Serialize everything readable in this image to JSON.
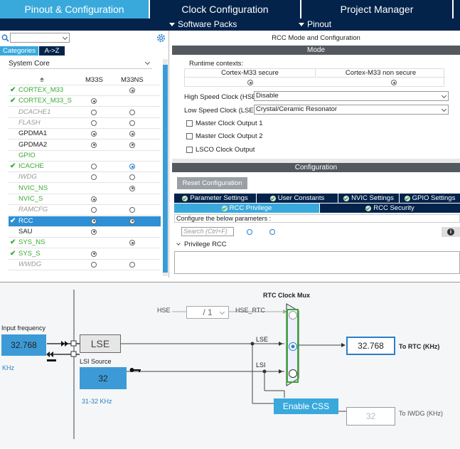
{
  "tabs": [
    "Pinout & Configuration",
    "Clock Configuration",
    "Project Manager"
  ],
  "subbar": {
    "software_packs": "Software Packs",
    "pinout": "Pinout"
  },
  "sidebar": {
    "categories_tab": "Categories",
    "az_tab": "A->Z",
    "group": "System Core",
    "col1": "M33S",
    "col2": "M33NS",
    "items": [
      {
        "name": "CORTEX_M33",
        "checked": true
      },
      {
        "name": "CORTEX_M33_S",
        "checked": true
      },
      {
        "name": "DCACHE1",
        "checked": false
      },
      {
        "name": "FLASH",
        "checked": false
      },
      {
        "name": "GPDMA1",
        "checked": false
      },
      {
        "name": "GPDMA2",
        "checked": false
      },
      {
        "name": "GPIO",
        "checked": false
      },
      {
        "name": "ICACHE",
        "checked": true
      },
      {
        "name": "IWDG",
        "checked": false
      },
      {
        "name": "NVIC_NS",
        "checked": false
      },
      {
        "name": "NVIC_S",
        "checked": false
      },
      {
        "name": "RAMCFG",
        "checked": false
      },
      {
        "name": "RCC",
        "checked": true
      },
      {
        "name": "SAU",
        "checked": false
      },
      {
        "name": "SYS_NS",
        "checked": true
      },
      {
        "name": "SYS_S",
        "checked": true
      },
      {
        "name": "WWDG",
        "checked": false
      }
    ]
  },
  "rcc": {
    "title": "RCC Mode and Configuration",
    "mode_header": "Mode",
    "runtime_label": "Runtime contexts:",
    "ctx_secure": "Cortex-M33 secure",
    "ctx_nonsecure": "Cortex-M33 non secure",
    "hse_label": "High Speed Clock (HSE)",
    "hse_value": "Disable",
    "lse_label": "Low Speed Clock (LSE)",
    "lse_value": "Crystal/Ceramic Resonator",
    "mco1": "Master Clock Output 1",
    "mco2": "Master Clock Output 2",
    "lsco": "LSCO Clock Output",
    "config_header": "Configuration",
    "reset_button": "Reset Configuration",
    "cfg_tabs": [
      "Parameter Settings",
      "User Constants",
      "NVIC Settings",
      "GPIO Settings"
    ],
    "privilege_tab": "RCC Privilege",
    "security_tab": "RCC Security",
    "configure_text": "Configure the below parameters :",
    "search_placeholder": "Search (Ctrl+F)",
    "privilege_group": "Privilege RCC"
  },
  "clock": {
    "mux_title": "RTC Clock Mux",
    "hse": "HSE",
    "divider": "/ 1",
    "hse_rtc": "HSE_RTC",
    "input_freq_label": "Input frequency",
    "input_freq": "32.768",
    "khz": "KHz",
    "lse": "LSE",
    "lsi_source": "LSI Source",
    "lsi_value": "32",
    "lsi_range": "31-32 KHz",
    "lse_line": "LSE",
    "lsi_line": "LSI",
    "rtc_value": "32.768",
    "rtc_label": "To RTC (KHz)",
    "enable_css": "Enable CSS",
    "iwdg_value": "32",
    "iwdg_label": "To IWDG (KHz)"
  },
  "colors": {
    "navy": "#03234b",
    "tab_active": "#39a9dc",
    "blue_box": "#3c9bd6",
    "selected_row": "#2f8fd4",
    "green": "#3aaa35"
  }
}
